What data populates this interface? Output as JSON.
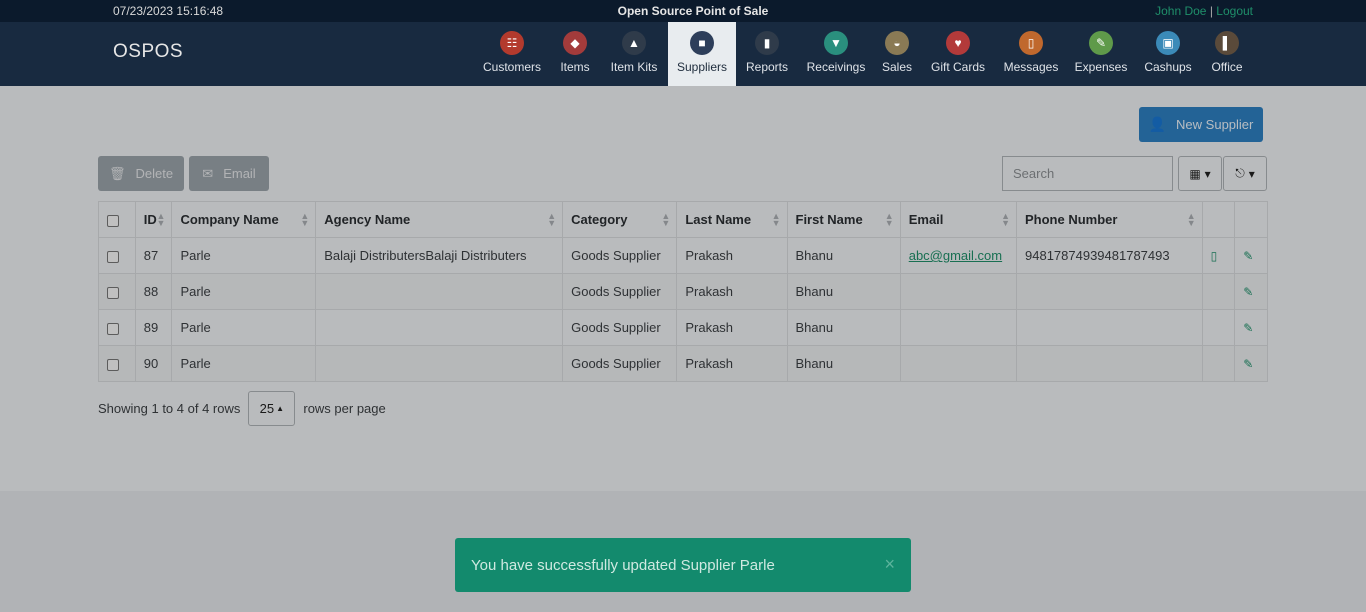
{
  "topbar": {
    "datetime": "07/23/2023 15:16:48",
    "app_title": "Open Source Point of Sale",
    "user_name": "John Doe",
    "separator": "|",
    "logout": "Logout"
  },
  "brand": "OSPOS",
  "nav": [
    {
      "label": "Customers",
      "icon": "customers-icon",
      "color": "#b33a2d",
      "glyph": "☷"
    },
    {
      "label": "Items",
      "icon": "tag-icon",
      "color": "#a33b3b",
      "glyph": "◆"
    },
    {
      "label": "Item Kits",
      "icon": "item-kits-icon",
      "color": "#2f3b4a",
      "glyph": "▲"
    },
    {
      "label": "Suppliers",
      "icon": "briefcase-icon",
      "color": "#2d3e5a",
      "glyph": "■"
    },
    {
      "label": "Reports",
      "icon": "bar-chart-icon",
      "color": "#2f3b4a",
      "glyph": "▮"
    },
    {
      "label": "Receivings",
      "icon": "truck-icon",
      "color": "#2a8f7e",
      "glyph": "▼"
    },
    {
      "label": "Sales",
      "icon": "basket-icon",
      "color": "#8a7a55",
      "glyph": "◒"
    },
    {
      "label": "Gift Cards",
      "icon": "heart-icon",
      "color": "#b33a3a",
      "glyph": "♥"
    },
    {
      "label": "Messages",
      "icon": "phone-icon",
      "color": "#c0682d",
      "glyph": "▯"
    },
    {
      "label": "Expenses",
      "icon": "expenses-icon",
      "color": "#5f9a4a",
      "glyph": "✎"
    },
    {
      "label": "Cashups",
      "icon": "cashups-icon",
      "color": "#3b8ab8",
      "glyph": "▣"
    },
    {
      "label": "Office",
      "icon": "door-icon",
      "color": "#5a4a3a",
      "glyph": "▌"
    }
  ],
  "toolbar": {
    "new_supplier": "New Supplier",
    "delete": "Delete",
    "email": "Email",
    "search_placeholder": "Search"
  },
  "table": {
    "columns": [
      "ID",
      "Company Name",
      "Agency Name",
      "Category",
      "Last Name",
      "First Name",
      "Email",
      "Phone Number"
    ],
    "rows": [
      {
        "id": "87",
        "company": "Parle",
        "agency": "Balaji DistributersBalaji Distributers",
        "category": "Goods Supplier",
        "last": "Prakash",
        "first": "Bhanu",
        "email": "abc@gmail.com",
        "phone": "94817874939481787493"
      },
      {
        "id": "88",
        "company": "Parle",
        "agency": "",
        "category": "Goods Supplier",
        "last": "Prakash",
        "first": "Bhanu",
        "email": "",
        "phone": ""
      },
      {
        "id": "89",
        "company": "Parle",
        "agency": "",
        "category": "Goods Supplier",
        "last": "Prakash",
        "first": "Bhanu",
        "email": "",
        "phone": ""
      },
      {
        "id": "90",
        "company": "Parle",
        "agency": "",
        "category": "Goods Supplier",
        "last": "Prakash",
        "first": "Bhanu",
        "email": "",
        "phone": ""
      }
    ]
  },
  "pagination": {
    "showing": "Showing 1 to 4 of 4 rows",
    "page_size": "25",
    "suffix": "rows per page"
  },
  "toast": {
    "message": "You have successfully updated Supplier Parle",
    "close": "×"
  }
}
